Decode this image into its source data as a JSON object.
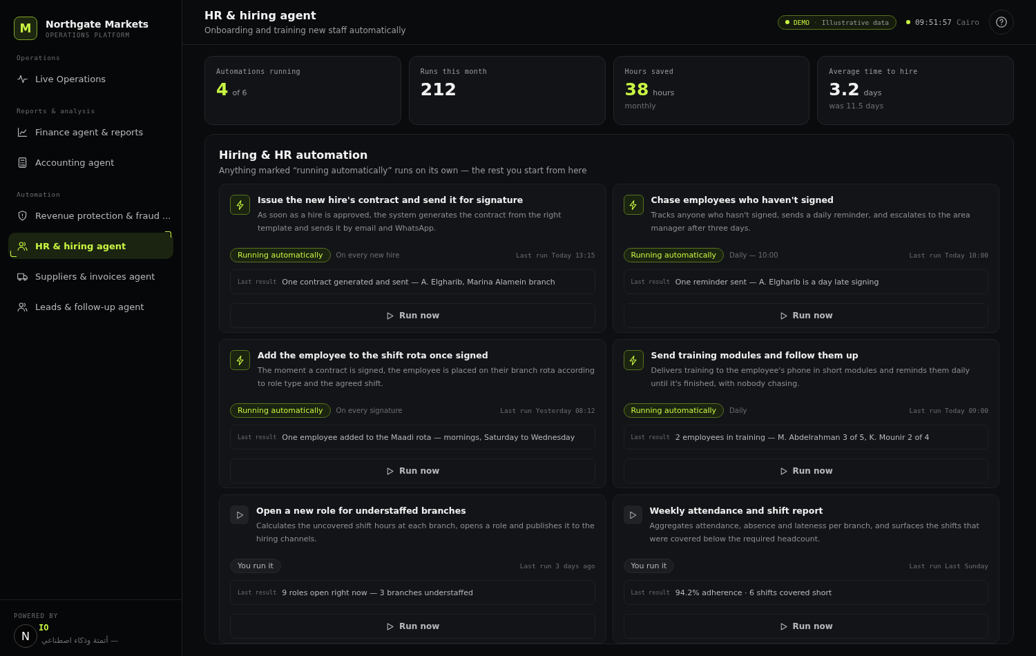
{
  "brand": {
    "logo": "M",
    "name": "Northgate Markets",
    "subtitle": "OPERATIONS PLATFORM"
  },
  "nav": [
    {
      "heading": "Operations",
      "items": [
        {
          "label": "Live Operations",
          "kind": "pulse",
          "selected": false
        }
      ]
    },
    {
      "heading": "Reports & analysis",
      "items": [
        {
          "label": "Finance agent & reports",
          "kind": "chart",
          "selected": false
        },
        {
          "label": "Accounting agent",
          "kind": "calculator",
          "selected": false
        }
      ]
    },
    {
      "heading": "Automation",
      "items": [
        {
          "label": "Revenue protection & fraud ...",
          "kind": "shield",
          "selected": false
        },
        {
          "label": "HR & hiring agent",
          "kind": "users",
          "selected": true
        },
        {
          "label": "Suppliers & invoices agent",
          "kind": "truck",
          "selected": false
        },
        {
          "label": "Leads & follow-up agent",
          "kind": "users",
          "selected": false
        }
      ]
    }
  ],
  "footer": {
    "label": "POWERED BY",
    "brand": "IO",
    "tagline": "أتمتة وذكاء اصطناعي —",
    "badge": "N"
  },
  "header": {
    "title": "HR & hiring agent",
    "subtitle": "Onboarding and training new staff automatically",
    "demo": "DEMO",
    "demo_sep": "·",
    "demo_note": "Illustrative data",
    "time": "09:51:57",
    "city": "Cairo"
  },
  "stats": [
    {
      "label": "Automations running",
      "value": "4",
      "unit": "of 6",
      "accent": true
    },
    {
      "label": "Runs this month",
      "value": "212",
      "accent": false
    },
    {
      "label": "Hours saved",
      "value": "38",
      "unit": "hours",
      "note": "monthly",
      "accent": true
    },
    {
      "label": "Average time to hire",
      "value": "3.2",
      "unit": "days",
      "note": "was 11.5 days",
      "accent": false
    }
  ],
  "section": {
    "title": "Hiring & HR automation",
    "subtitle": "Anything marked “running automatically” runs on its own — the rest you start from here"
  },
  "cards": [
    {
      "kind": "auto",
      "title": "Issue the new hire's contract and send it for signature",
      "description": "As soon as a hire is approved, the system generates the contract from the right template and sends it by email and WhatsApp.",
      "status": "Running automatically",
      "trigger": "On every new hire",
      "last_run_label": "Last run",
      "last_run": "Today 13:15",
      "result_label": "Last result",
      "result": "One contract generated and sent — A. Elgharib, Marina Alamein branch",
      "action": "Run now"
    },
    {
      "kind": "auto",
      "title": "Chase employees who haven't signed",
      "description": "Tracks anyone who hasn't signed, sends a daily reminder, and escalates to the area manager after three days.",
      "status": "Running automatically",
      "trigger": "Daily — 10:00",
      "last_run_label": "Last run",
      "last_run": "Today 10:00",
      "result_label": "Last result",
      "result": "One reminder sent — A. Elgharib is a day late signing",
      "action": "Run now"
    },
    {
      "kind": "auto",
      "title": "Add the employee to the shift rota once signed",
      "description": "The moment a contract is signed, the employee is placed on their branch rota according to role type and the agreed shift.",
      "status": "Running automatically",
      "trigger": "On every signature",
      "last_run_label": "Last run",
      "last_run": "Yesterday 08:12",
      "result_label": "Last result",
      "result": "One employee added to the Maadi rota — mornings, Saturday to Wednesday",
      "action": "Run now"
    },
    {
      "kind": "auto",
      "title": "Send training modules and follow them up",
      "description": "Delivers training to the employee's phone in short modules and reminds them daily until it's finished, with nobody chasing.",
      "status": "Running automatically",
      "trigger": "Daily",
      "last_run_label": "Last run",
      "last_run": "Today 09:00",
      "result_label": "Last result",
      "result": "2 employees in training — M. Abdelrahman 3 of 5, K. Mounir 2 of 4",
      "action": "Run now"
    },
    {
      "kind": "manual",
      "title": "Open a new role for understaffed branches",
      "description": "Calculates the uncovered shift hours at each branch, opens a role and publishes it to the hiring channels.",
      "status": "You run it",
      "last_run_label": "Last run",
      "last_run": "3 days ago",
      "result_label": "Last result",
      "result": "9 roles open right now — 3 branches understaffed",
      "action": "Run now"
    },
    {
      "kind": "manual",
      "title": "Weekly attendance and shift report",
      "description": "Aggregates attendance, absence and lateness per branch, and surfaces the shifts that were covered below the required headcount.",
      "status": "You run it",
      "last_run_label": "Last run",
      "last_run": "Last Sunday",
      "result_label": "Last result",
      "result": "94.2% adherence · 6 shifts covered short",
      "action": "Run now"
    }
  ]
}
